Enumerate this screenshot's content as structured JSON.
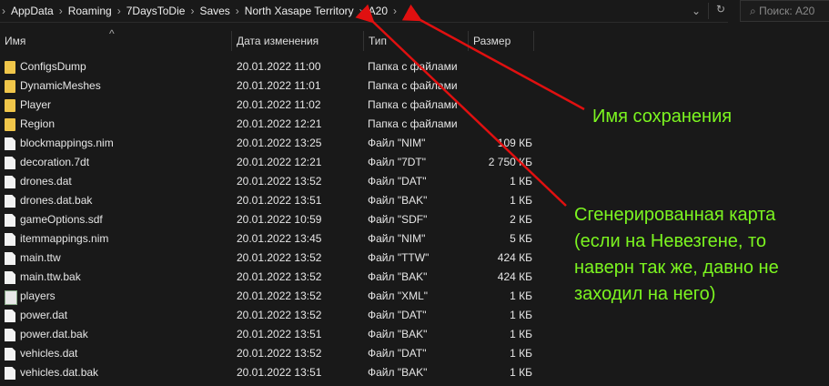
{
  "breadcrumb": [
    "AppData",
    "Roaming",
    "7DaysToDie",
    "Saves",
    "North Xasape Territory",
    "A20"
  ],
  "search_placeholder": "Поиск: A20",
  "columns": {
    "name": "Имя",
    "date": "Дата изменения",
    "type": "Тип",
    "size": "Размер"
  },
  "files": [
    {
      "name": "ConfigsDump",
      "date": "20.01.2022 11:00",
      "type": "Папка с файлами",
      "size": "",
      "icon": "folder"
    },
    {
      "name": "DynamicMeshes",
      "date": "20.01.2022 11:01",
      "type": "Папка с файлами",
      "size": "",
      "icon": "folder"
    },
    {
      "name": "Player",
      "date": "20.01.2022 11:02",
      "type": "Папка с файлами",
      "size": "",
      "icon": "folder"
    },
    {
      "name": "Region",
      "date": "20.01.2022 12:21",
      "type": "Папка с файлами",
      "size": "",
      "icon": "folder"
    },
    {
      "name": "blockmappings.nim",
      "date": "20.01.2022 13:25",
      "type": "Файл \"NIM\"",
      "size": "109 КБ",
      "icon": "file"
    },
    {
      "name": "decoration.7dt",
      "date": "20.01.2022 12:21",
      "type": "Файл \"7DT\"",
      "size": "2 750 КБ",
      "icon": "file"
    },
    {
      "name": "drones.dat",
      "date": "20.01.2022 13:52",
      "type": "Файл \"DAT\"",
      "size": "1 КБ",
      "icon": "file"
    },
    {
      "name": "drones.dat.bak",
      "date": "20.01.2022 13:51",
      "type": "Файл \"BAK\"",
      "size": "1 КБ",
      "icon": "file"
    },
    {
      "name": "gameOptions.sdf",
      "date": "20.01.2022 10:59",
      "type": "Файл \"SDF\"",
      "size": "2 КБ",
      "icon": "file"
    },
    {
      "name": "itemmappings.nim",
      "date": "20.01.2022 13:45",
      "type": "Файл \"NIM\"",
      "size": "5 КБ",
      "icon": "file"
    },
    {
      "name": "main.ttw",
      "date": "20.01.2022 13:52",
      "type": "Файл \"TTW\"",
      "size": "424 КБ",
      "icon": "file"
    },
    {
      "name": "main.ttw.bak",
      "date": "20.01.2022 13:52",
      "type": "Файл \"BAK\"",
      "size": "424 КБ",
      "icon": "file"
    },
    {
      "name": "players",
      "date": "20.01.2022 13:52",
      "type": "Файл \"XML\"",
      "size": "1 КБ",
      "icon": "xml"
    },
    {
      "name": "power.dat",
      "date": "20.01.2022 13:52",
      "type": "Файл \"DAT\"",
      "size": "1 КБ",
      "icon": "file"
    },
    {
      "name": "power.dat.bak",
      "date": "20.01.2022 13:51",
      "type": "Файл \"BAK\"",
      "size": "1 КБ",
      "icon": "file"
    },
    {
      "name": "vehicles.dat",
      "date": "20.01.2022 13:52",
      "type": "Файл \"DAT\"",
      "size": "1 КБ",
      "icon": "file"
    },
    {
      "name": "vehicles.dat.bak",
      "date": "20.01.2022 13:51",
      "type": "Файл \"BAK\"",
      "size": "1 КБ",
      "icon": "file"
    }
  ],
  "annotations": {
    "save_name": "Имя сохранения",
    "map_lines": [
      "Сгенерированная карта",
      "(если на Невезгене, то",
      "наверн так же, давно не",
      "заходил на него)"
    ]
  },
  "colors": {
    "arrow": "#e01010",
    "note": "#7cf520"
  }
}
